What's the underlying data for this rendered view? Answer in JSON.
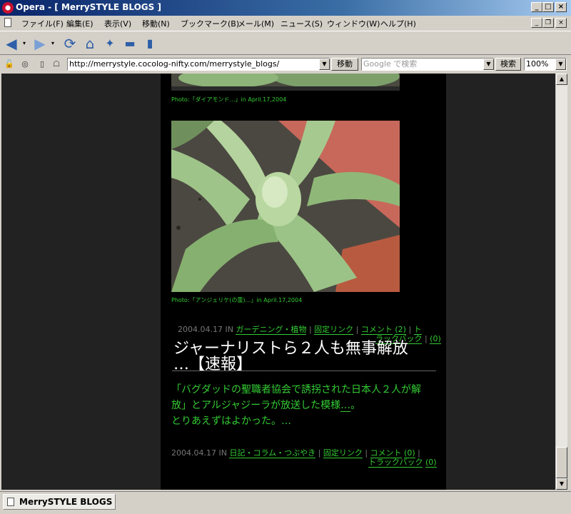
{
  "window": {
    "title": "Opera - [ MerrySTYLE BLOGS ]"
  },
  "menu": {
    "items": [
      "ファイル(F)",
      "編集(E)",
      "表示(V)",
      "移動(N)",
      "ブックマーク(B)",
      "メール(M)",
      "ニュース(S)",
      "ウィンドウ(W)",
      "ヘルプ(H)"
    ]
  },
  "toolbar": {
    "icons": [
      "back-icon",
      "forward-icon",
      "reload-icon",
      "home-icon",
      "hotlist-icon",
      "print-icon",
      "page-icon"
    ]
  },
  "addressbar": {
    "url": "http://merrystyle.cocolog-nifty.com/merrystyle_blogs/",
    "go_label": "移動",
    "search_placeholder": "Google で検索",
    "search_label": "検索",
    "zoom": "100%"
  },
  "page": {
    "photo1_caption": "Photo:「ダイアモンド…」in April.17,2004",
    "photo2_caption": "Photo:「アンジェリケ(の蕾)…」in April.17,2004",
    "post1_footer": {
      "date": "2004.04.17",
      "in": "IN",
      "category": "ガーデニング・植物",
      "permalink": "固定リンク",
      "comment": "コメント",
      "comment_count": "(2)",
      "trackback_a": "ト",
      "trackback_b": "ラックバック",
      "trackback_count": "(0)"
    },
    "post2": {
      "title_line1": "ジャーナリストら２人も無事解放",
      "title_line2": "…【速報】",
      "body_line1": "「バグダッドの聖職者協会で誘拐された日本人２人が解",
      "body_line2a": "放」とアルジャジーラが放送した模様",
      "body_line2b": "…",
      "body_line2c": "。",
      "body_line3": "とりあえずはよかった。…"
    },
    "post2_footer": {
      "date": "2004.04.17",
      "in": "IN",
      "category": "日記・コラム・つぶやき",
      "permalink": "固定リンク",
      "comment": "コメント",
      "comment_count": "(0)",
      "trackback": "トラックバック",
      "trackback_count": "(0)"
    }
  },
  "tabs": [
    {
      "label": "MerrySTYLE BLOGS"
    }
  ]
}
